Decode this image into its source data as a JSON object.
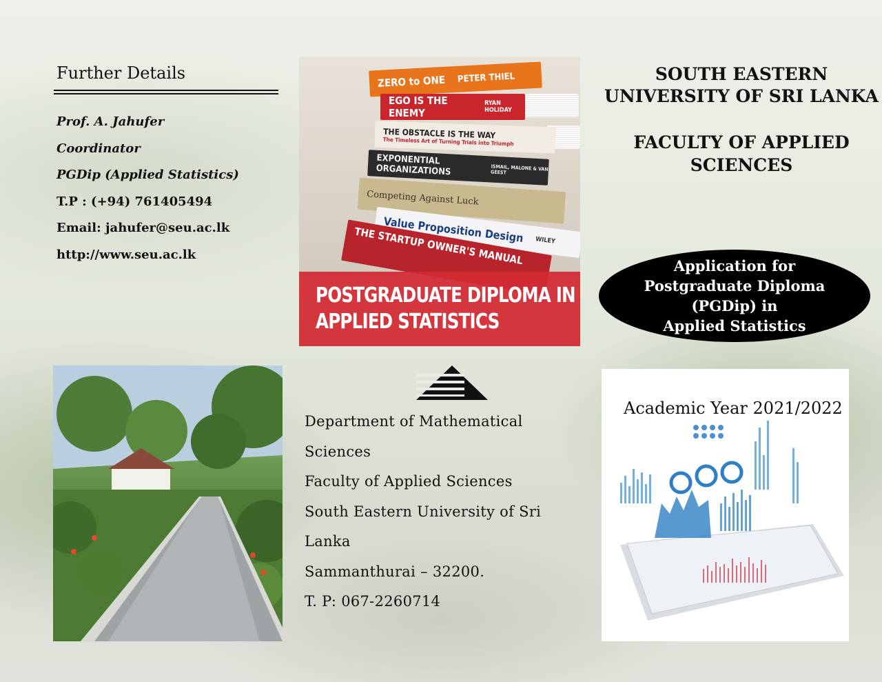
{
  "further": {
    "title": "Further Details",
    "name": "Prof. A. Jahufer",
    "role": "Coordinator",
    "program": "PGDip (Applied Statistics)",
    "phone": "T.P : (+94) 761405494",
    "email": "Email: jahufer@seu.ac.lk",
    "web": "http://www.seu.ac.lk"
  },
  "cover": {
    "books": [
      "ZERO to ONE",
      "PETER THIEL",
      "EGO IS THE ENEMY",
      "RYAN HOLIDAY",
      "THE OBSTACLE IS THE WAY",
      "The Timeless Art of Turning Trials into Triumph",
      "EXPONENTIAL ORGANIZATIONS",
      "ISMAIL, MALONE & VAN GEEST",
      "Competing Against Luck",
      "Value Proposition Design",
      "THE STARTUP OWNER'S MANUAL",
      "WILEY"
    ],
    "banner_line1": "POSTGRADUATE DIPLOMA IN",
    "banner_line2": "APPLIED STATISTICS"
  },
  "university": {
    "line1": "SOUTH EASTERN",
    "line2": "UNIVERSITY OF SRI LANKA",
    "faculty_line1": "FACULTY OF APPLIED",
    "faculty_line2": "SCIENCES"
  },
  "application": {
    "line1": "Application for",
    "line2": "Postgraduate Diploma",
    "line3": "(PGDip) in",
    "line4": "Applied Statistics"
  },
  "department": {
    "line1": "Department of Mathematical",
    "line2": "Sciences",
    "line3": "Faculty of Applied Sciences",
    "line4": "South Eastern University of Sri",
    "line5": "Lanka",
    "line6": "Sammanthurai – 32200.",
    "line7": "T. P: 067-2260714"
  },
  "academic_year": "Academic Year 2021/2022",
  "colors": {
    "banner_red": "#d32b34",
    "book_orange": "#e8741c",
    "book_red": "#c8262c"
  }
}
